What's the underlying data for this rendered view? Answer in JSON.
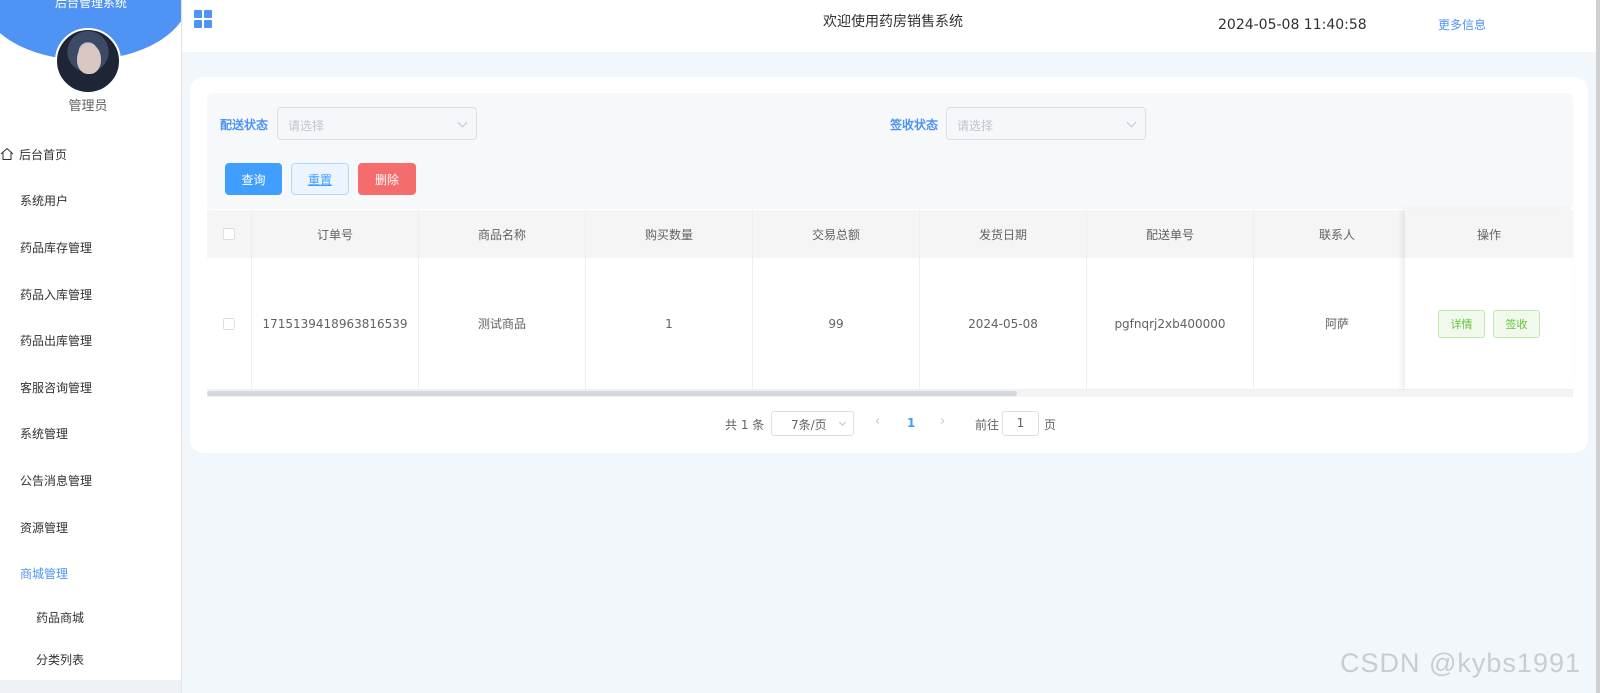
{
  "sidebar": {
    "system_name": "后台管理系统",
    "role": "管理员",
    "items": [
      {
        "label": "后台首页"
      },
      {
        "label": "系统用户"
      },
      {
        "label": "药品库存管理"
      },
      {
        "label": "药品入库管理"
      },
      {
        "label": "药品出库管理"
      },
      {
        "label": "客服咨询管理"
      },
      {
        "label": "系统管理"
      },
      {
        "label": "公告消息管理"
      },
      {
        "label": "资源管理"
      },
      {
        "label": "商城管理",
        "active": true
      }
    ],
    "sub_items": [
      {
        "label": "药品商城"
      },
      {
        "label": "分类列表"
      }
    ]
  },
  "header": {
    "title": "欢迎使用药房销售系统",
    "datetime": "2024-05-08 11:40:58",
    "more": "更多信息"
  },
  "filters": {
    "delivery_label": "配送状态",
    "delivery_placeholder": "请选择",
    "sign_label": "签收状态",
    "sign_placeholder": "请选择"
  },
  "buttons": {
    "query": "查询",
    "reset": "重置",
    "delete": "删除"
  },
  "table": {
    "columns": [
      "订单号",
      "商品名称",
      "购买数量",
      "交易总额",
      "发货日期",
      "配送单号",
      "联系人"
    ],
    "ops_header": "操作",
    "rows": [
      {
        "order_no": "1715139418963816539",
        "product": "测试商品",
        "qty": "1",
        "total": "99",
        "ship_date": "2024-05-08",
        "delivery_no": "pgfnqrj2xb400000",
        "contact": "阿萨",
        "detail": "详情",
        "sign": "签收"
      }
    ]
  },
  "pagination": {
    "total": "共 1 条",
    "page_size": "7条/页",
    "current_page": "1",
    "goto": "前往",
    "goto_value": "1",
    "page_unit": "页"
  },
  "watermark": "CSDN @kybs1991",
  "colors": {
    "accent": "#4f93f5",
    "danger": "#f56c6c",
    "success": "#67c23a"
  }
}
